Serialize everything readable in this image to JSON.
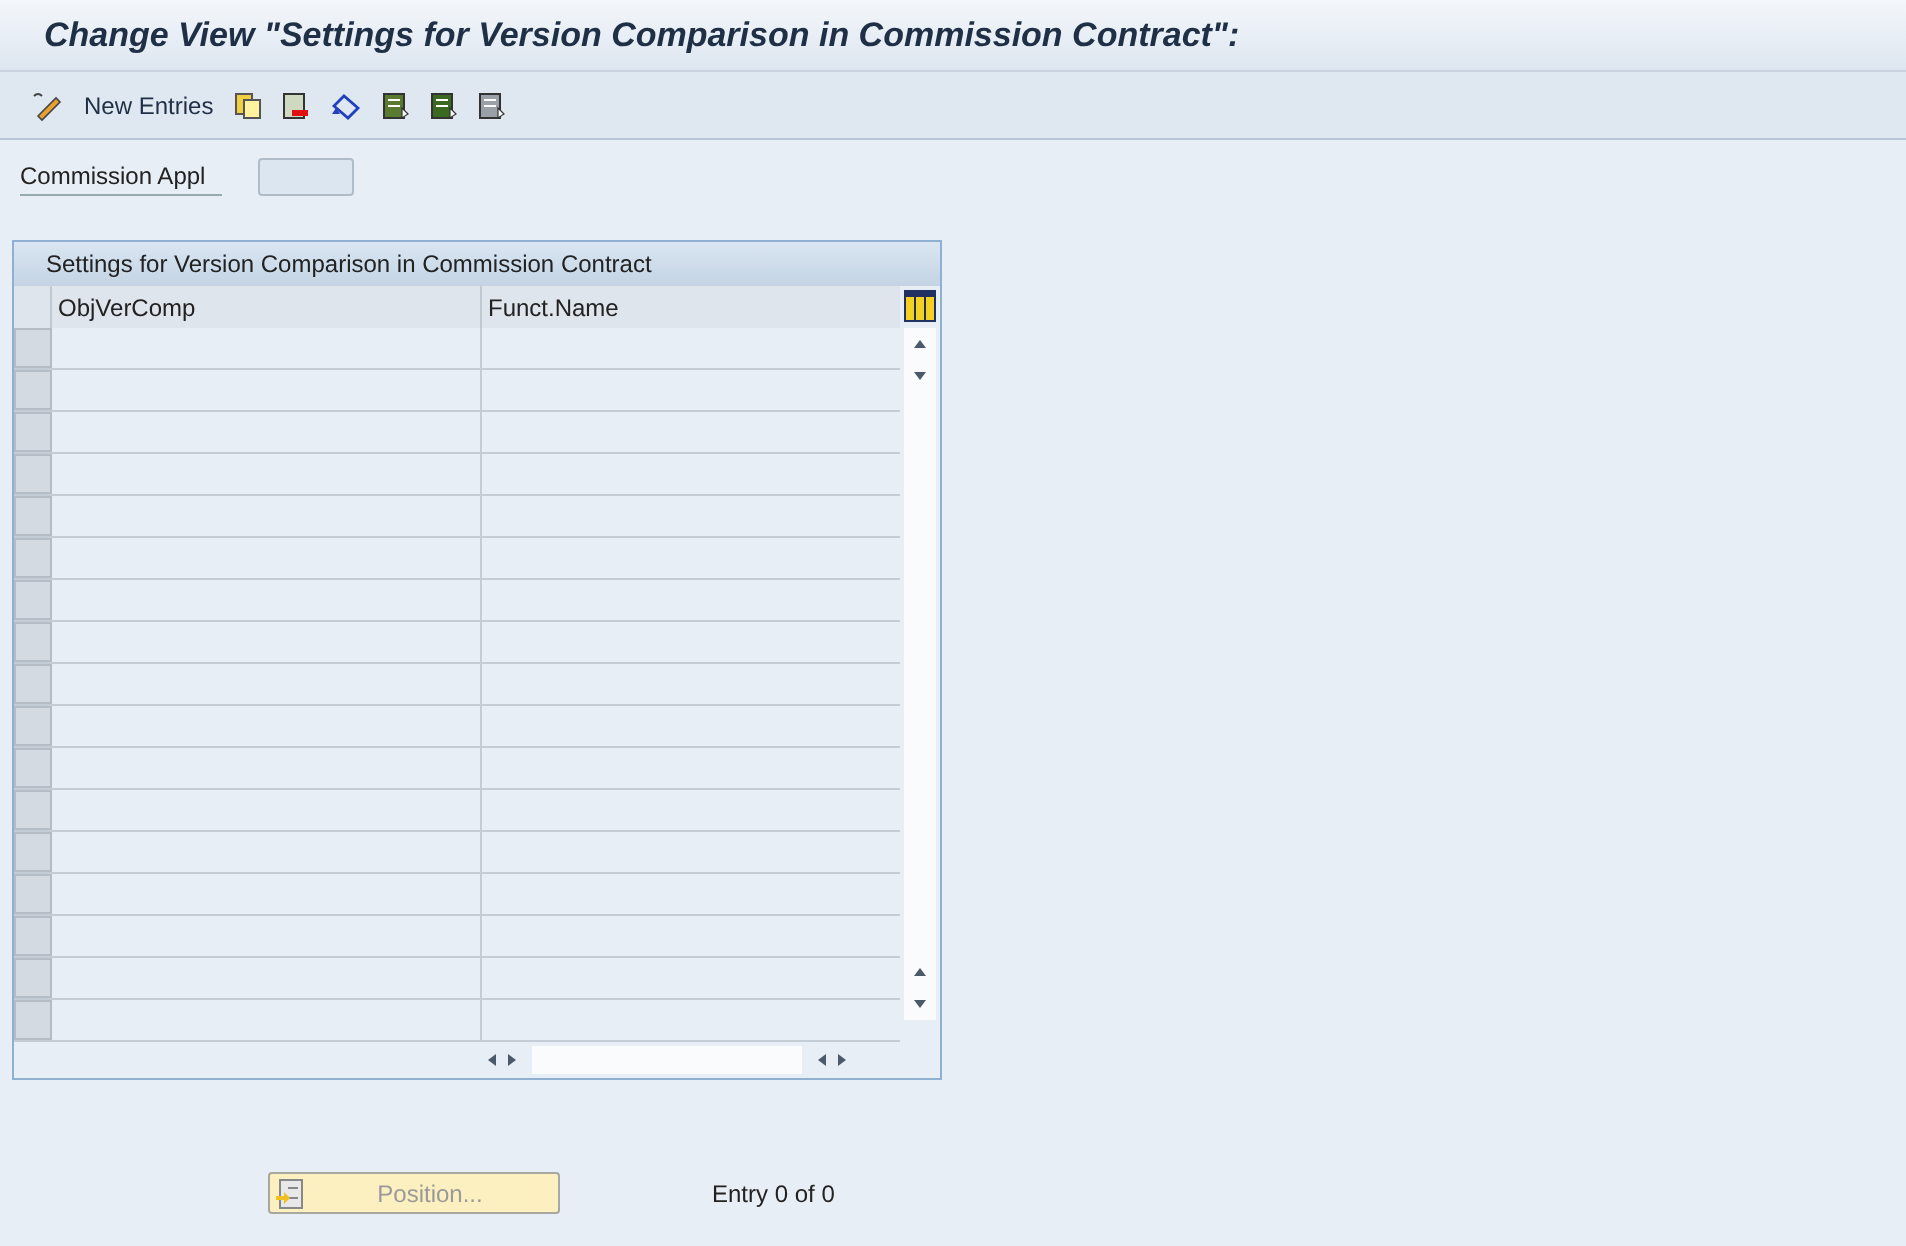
{
  "window": {
    "title": "Change View \"Settings for Version Comparison in Commission Contract\":"
  },
  "toolbar": {
    "new_entries": "New Entries"
  },
  "field": {
    "label": "Commission Appl"
  },
  "table": {
    "title": "Settings for Version Comparison in Commission Contract",
    "columns": [
      "ObjVerComp",
      "Funct.Name"
    ]
  },
  "position_button": {
    "label": "Position...",
    "disabled": true
  },
  "entry_count": "Entry 0 of 0"
}
